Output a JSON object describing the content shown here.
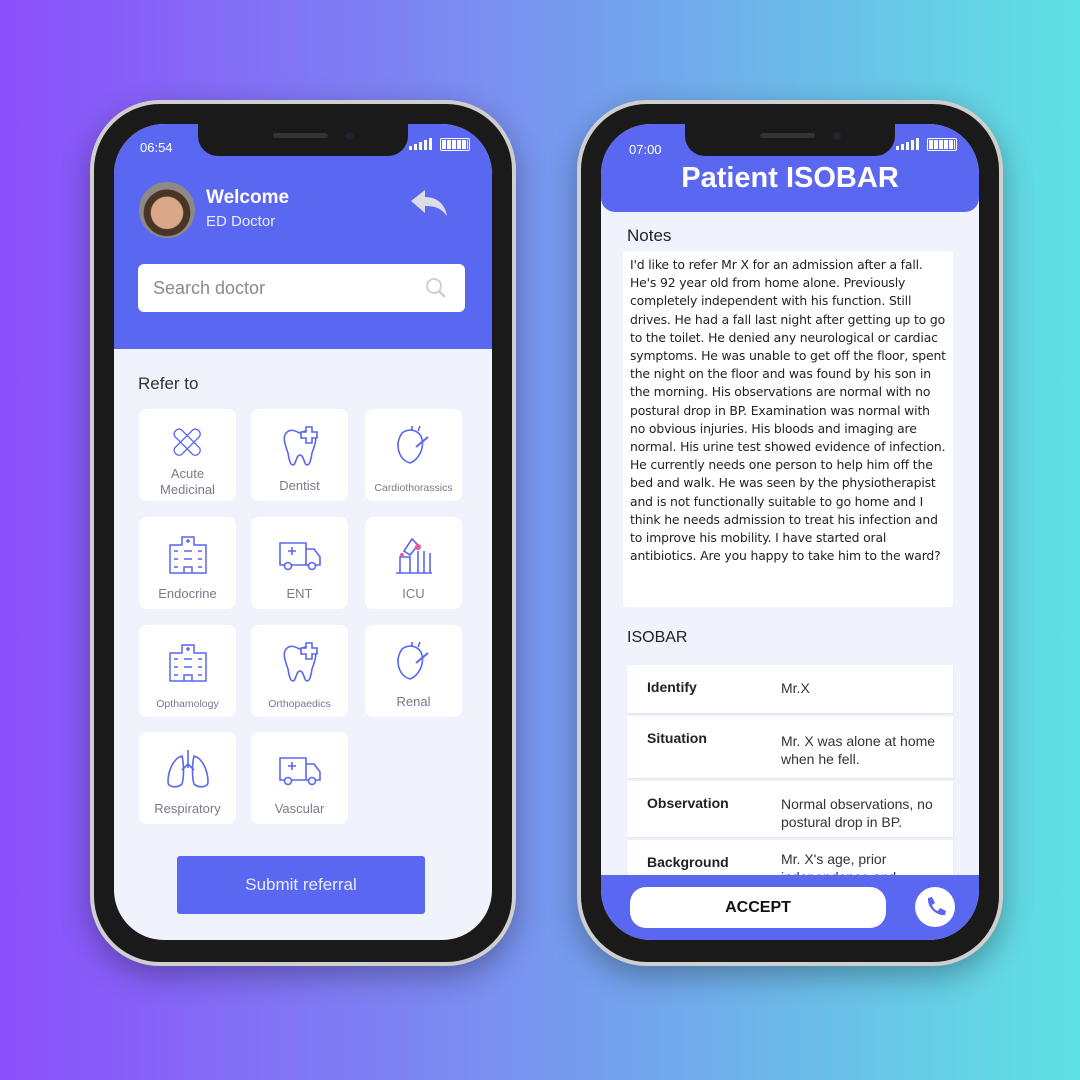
{
  "colors": {
    "primary": "#5a67f0",
    "background_left": "#8b4ffb",
    "background_right": "#5fe2e2"
  },
  "left_phone": {
    "status_time": "06:54",
    "welcome": "Welcome",
    "role": "ED Doctor",
    "search_placeholder": "Search doctor",
    "section_label": "Refer to",
    "specialties": [
      {
        "label": "Acute Medicinal",
        "icon": "bandage-icon"
      },
      {
        "label": "Dentist",
        "icon": "tooth-icon"
      },
      {
        "label": "Cardiothorassics",
        "icon": "heart-icon"
      },
      {
        "label": "Endocrine",
        "icon": "hospital-icon"
      },
      {
        "label": "ENT",
        "icon": "ambulance-icon"
      },
      {
        "label": "ICU",
        "icon": "lab-icon"
      },
      {
        "label": "Opthamology",
        "icon": "hospital-icon"
      },
      {
        "label": "Orthopaedics",
        "icon": "tooth-icon"
      },
      {
        "label": "Renal",
        "icon": "heart-icon"
      },
      {
        "label": "Respiratory",
        "icon": "lungs-icon"
      },
      {
        "label": "Vascular",
        "icon": "ambulance-icon"
      }
    ],
    "submit": "Submit referral"
  },
  "right_phone": {
    "status_time": "07:00",
    "title": "Patient ISOBAR",
    "notes_label": "Notes",
    "notes": "I'd like to refer Mr X for an admission after a fall. He's 92 year old from home alone. Previously completely independent with his function. Still drives. He had a fall last night after getting up to go to the toilet. He denied any neurological or cardiac symptoms. He was unable to get off the floor, spent the night on the floor and was found by his son in the morning. His observations are normal with no postural drop in BP. Examination was normal with no obvious injuries. His bloods and imaging are normal. His urine test showed evidence of infection. He currently needs one person to help him off the bed and walk. He was seen by the physiotherapist and is not functionally suitable to go home and I think he needs admission to treat his infection and to improve his mobility. I have started oral antibiotics. Are you happy to take him to the ward?",
    "isobar_label": "ISOBAR",
    "isobar": [
      {
        "key": "Identify",
        "value": "Mr.X"
      },
      {
        "key": "Situation",
        "value": "Mr. X was alone at home when he fell."
      },
      {
        "key": "Observation",
        "value": "Normal observations, no postural drop in BP."
      },
      {
        "key": "Background",
        "value": "Mr. X's age, prior independence and..."
      }
    ],
    "accept": "ACCEPT"
  }
}
